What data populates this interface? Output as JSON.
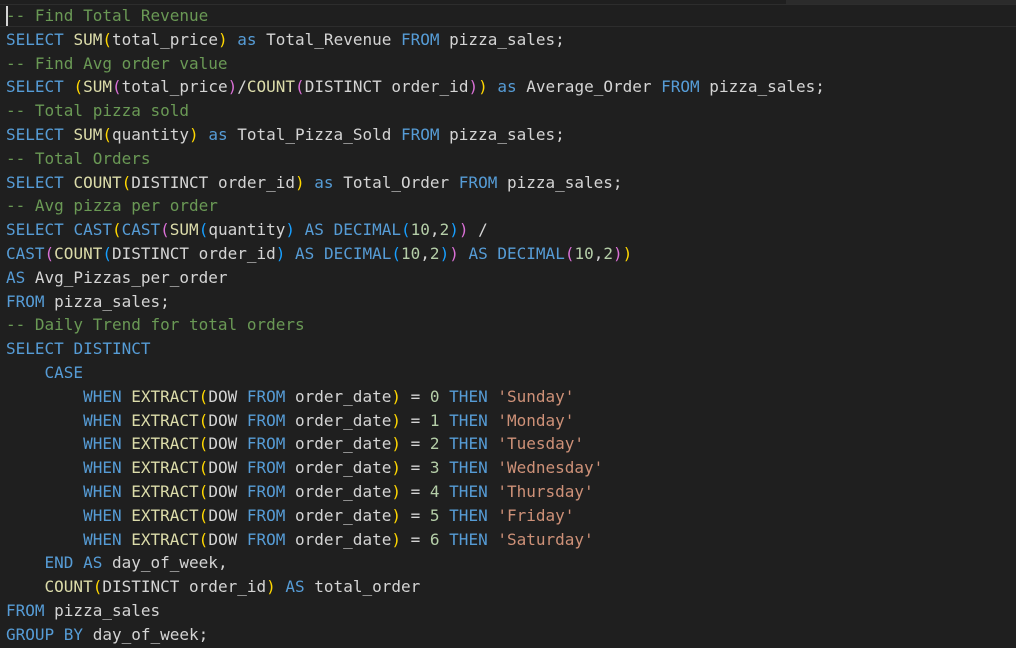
{
  "colors": {
    "background": "#1f1f1f",
    "default": "#d4d4d4",
    "keyword": "#569cd6",
    "function": "#dcdcaa",
    "comment": "#6a9955",
    "string": "#ce9178",
    "number": "#b5cea8",
    "paren1": "#ffd700",
    "paren2": "#da70d6",
    "paren3": "#179fff"
  },
  "editor": {
    "lines": [
      [
        [
          "comment",
          "-- Find Total Revenue"
        ]
      ],
      [
        [
          "keyword",
          "SELECT"
        ],
        [
          "default",
          " "
        ],
        [
          "function",
          "SUM"
        ],
        [
          "paren1",
          "("
        ],
        [
          "default",
          "total_price"
        ],
        [
          "paren1",
          ")"
        ],
        [
          "default",
          " "
        ],
        [
          "keyword",
          "as"
        ],
        [
          "default",
          " Total_Revenue "
        ],
        [
          "keyword",
          "FROM"
        ],
        [
          "default",
          " pizza_sales;"
        ]
      ],
      [
        [
          "comment",
          "-- Find Avg order value"
        ]
      ],
      [
        [
          "keyword",
          "SELECT"
        ],
        [
          "default",
          " "
        ],
        [
          "paren1",
          "("
        ],
        [
          "function",
          "SUM"
        ],
        [
          "paren2",
          "("
        ],
        [
          "default",
          "total_price"
        ],
        [
          "paren2",
          ")"
        ],
        [
          "default",
          "/"
        ],
        [
          "function",
          "COUNT"
        ],
        [
          "paren2",
          "("
        ],
        [
          "default",
          "DISTINCT order_id"
        ],
        [
          "paren2",
          ")"
        ],
        [
          "paren1",
          ")"
        ],
        [
          "default",
          " "
        ],
        [
          "keyword",
          "as"
        ],
        [
          "default",
          " Average_Order "
        ],
        [
          "keyword",
          "FROM"
        ],
        [
          "default",
          " pizza_sales;"
        ]
      ],
      [
        [
          "comment",
          "-- Total pizza sold"
        ]
      ],
      [
        [
          "keyword",
          "SELECT"
        ],
        [
          "default",
          " "
        ],
        [
          "function",
          "SUM"
        ],
        [
          "paren1",
          "("
        ],
        [
          "default",
          "quantity"
        ],
        [
          "paren1",
          ")"
        ],
        [
          "default",
          " "
        ],
        [
          "keyword",
          "as"
        ],
        [
          "default",
          " Total_Pizza_Sold "
        ],
        [
          "keyword",
          "FROM"
        ],
        [
          "default",
          " pizza_sales;"
        ]
      ],
      [
        [
          "comment",
          "-- Total Orders"
        ]
      ],
      [
        [
          "keyword",
          "SELECT"
        ],
        [
          "default",
          " "
        ],
        [
          "function",
          "COUNT"
        ],
        [
          "paren1",
          "("
        ],
        [
          "default",
          "DISTINCT order_id"
        ],
        [
          "paren1",
          ")"
        ],
        [
          "default",
          " "
        ],
        [
          "keyword",
          "as"
        ],
        [
          "default",
          " Total_Order "
        ],
        [
          "keyword",
          "FROM"
        ],
        [
          "default",
          " pizza_sales;"
        ]
      ],
      [
        [
          "comment",
          "-- Avg pizza per order"
        ]
      ],
      [
        [
          "keyword",
          "SELECT"
        ],
        [
          "default",
          " "
        ],
        [
          "keyword",
          "CAST"
        ],
        [
          "paren1",
          "("
        ],
        [
          "keyword",
          "CAST"
        ],
        [
          "paren2",
          "("
        ],
        [
          "function",
          "SUM"
        ],
        [
          "paren3",
          "("
        ],
        [
          "default",
          "quantity"
        ],
        [
          "paren3",
          ")"
        ],
        [
          "default",
          " "
        ],
        [
          "keyword",
          "AS"
        ],
        [
          "default",
          " "
        ],
        [
          "keyword",
          "DECIMAL"
        ],
        [
          "paren3",
          "("
        ],
        [
          "number",
          "10"
        ],
        [
          "default",
          ","
        ],
        [
          "number",
          "2"
        ],
        [
          "paren3",
          ")"
        ],
        [
          "paren2",
          ")"
        ],
        [
          "default",
          " /"
        ]
      ],
      [
        [
          "keyword",
          "CAST"
        ],
        [
          "paren2",
          "("
        ],
        [
          "function",
          "COUNT"
        ],
        [
          "paren3",
          "("
        ],
        [
          "default",
          "DISTINCT order_id"
        ],
        [
          "paren3",
          ")"
        ],
        [
          "default",
          " "
        ],
        [
          "keyword",
          "AS"
        ],
        [
          "default",
          " "
        ],
        [
          "keyword",
          "DECIMAL"
        ],
        [
          "paren3",
          "("
        ],
        [
          "number",
          "10"
        ],
        [
          "default",
          ","
        ],
        [
          "number",
          "2"
        ],
        [
          "paren3",
          ")"
        ],
        [
          "paren2",
          ")"
        ],
        [
          "default",
          " "
        ],
        [
          "keyword",
          "AS"
        ],
        [
          "default",
          " "
        ],
        [
          "keyword",
          "DECIMAL"
        ],
        [
          "paren2",
          "("
        ],
        [
          "number",
          "10"
        ],
        [
          "default",
          ","
        ],
        [
          "number",
          "2"
        ],
        [
          "paren2",
          ")"
        ],
        [
          "paren1",
          ")"
        ]
      ],
      [
        [
          "keyword",
          "AS"
        ],
        [
          "default",
          " Avg_Pizzas_per_order"
        ]
      ],
      [
        [
          "keyword",
          "FROM"
        ],
        [
          "default",
          " pizza_sales;"
        ]
      ],
      [
        [
          "comment",
          "-- Daily Trend for total orders"
        ]
      ],
      [
        [
          "keyword",
          "SELECT"
        ],
        [
          "default",
          " "
        ],
        [
          "keyword",
          "DISTINCT"
        ]
      ],
      [
        [
          "default",
          "    "
        ],
        [
          "keyword",
          "CASE"
        ]
      ],
      [
        [
          "default",
          "        "
        ],
        [
          "keyword",
          "WHEN"
        ],
        [
          "default",
          " "
        ],
        [
          "function",
          "EXTRACT"
        ],
        [
          "paren1",
          "("
        ],
        [
          "default",
          "DOW "
        ],
        [
          "keyword",
          "FROM"
        ],
        [
          "default",
          " order_date"
        ],
        [
          "paren1",
          ")"
        ],
        [
          "default",
          " = "
        ],
        [
          "number",
          "0"
        ],
        [
          "default",
          " "
        ],
        [
          "keyword",
          "THEN"
        ],
        [
          "default",
          " "
        ],
        [
          "string",
          "'Sunday'"
        ]
      ],
      [
        [
          "default",
          "        "
        ],
        [
          "keyword",
          "WHEN"
        ],
        [
          "default",
          " "
        ],
        [
          "function",
          "EXTRACT"
        ],
        [
          "paren1",
          "("
        ],
        [
          "default",
          "DOW "
        ],
        [
          "keyword",
          "FROM"
        ],
        [
          "default",
          " order_date"
        ],
        [
          "paren1",
          ")"
        ],
        [
          "default",
          " = "
        ],
        [
          "number",
          "1"
        ],
        [
          "default",
          " "
        ],
        [
          "keyword",
          "THEN"
        ],
        [
          "default",
          " "
        ],
        [
          "string",
          "'Monday'"
        ]
      ],
      [
        [
          "default",
          "        "
        ],
        [
          "keyword",
          "WHEN"
        ],
        [
          "default",
          " "
        ],
        [
          "function",
          "EXTRACT"
        ],
        [
          "paren1",
          "("
        ],
        [
          "default",
          "DOW "
        ],
        [
          "keyword",
          "FROM"
        ],
        [
          "default",
          " order_date"
        ],
        [
          "paren1",
          ")"
        ],
        [
          "default",
          " = "
        ],
        [
          "number",
          "2"
        ],
        [
          "default",
          " "
        ],
        [
          "keyword",
          "THEN"
        ],
        [
          "default",
          " "
        ],
        [
          "string",
          "'Tuesday'"
        ]
      ],
      [
        [
          "default",
          "        "
        ],
        [
          "keyword",
          "WHEN"
        ],
        [
          "default",
          " "
        ],
        [
          "function",
          "EXTRACT"
        ],
        [
          "paren1",
          "("
        ],
        [
          "default",
          "DOW "
        ],
        [
          "keyword",
          "FROM"
        ],
        [
          "default",
          " order_date"
        ],
        [
          "paren1",
          ")"
        ],
        [
          "default",
          " = "
        ],
        [
          "number",
          "3"
        ],
        [
          "default",
          " "
        ],
        [
          "keyword",
          "THEN"
        ],
        [
          "default",
          " "
        ],
        [
          "string",
          "'Wednesday'"
        ]
      ],
      [
        [
          "default",
          "        "
        ],
        [
          "keyword",
          "WHEN"
        ],
        [
          "default",
          " "
        ],
        [
          "function",
          "EXTRACT"
        ],
        [
          "paren1",
          "("
        ],
        [
          "default",
          "DOW "
        ],
        [
          "keyword",
          "FROM"
        ],
        [
          "default",
          " order_date"
        ],
        [
          "paren1",
          ")"
        ],
        [
          "default",
          " = "
        ],
        [
          "number",
          "4"
        ],
        [
          "default",
          " "
        ],
        [
          "keyword",
          "THEN"
        ],
        [
          "default",
          " "
        ],
        [
          "string",
          "'Thursday'"
        ]
      ],
      [
        [
          "default",
          "        "
        ],
        [
          "keyword",
          "WHEN"
        ],
        [
          "default",
          " "
        ],
        [
          "function",
          "EXTRACT"
        ],
        [
          "paren1",
          "("
        ],
        [
          "default",
          "DOW "
        ],
        [
          "keyword",
          "FROM"
        ],
        [
          "default",
          " order_date"
        ],
        [
          "paren1",
          ")"
        ],
        [
          "default",
          " = "
        ],
        [
          "number",
          "5"
        ],
        [
          "default",
          " "
        ],
        [
          "keyword",
          "THEN"
        ],
        [
          "default",
          " "
        ],
        [
          "string",
          "'Friday'"
        ]
      ],
      [
        [
          "default",
          "        "
        ],
        [
          "keyword",
          "WHEN"
        ],
        [
          "default",
          " "
        ],
        [
          "function",
          "EXTRACT"
        ],
        [
          "paren1",
          "("
        ],
        [
          "default",
          "DOW "
        ],
        [
          "keyword",
          "FROM"
        ],
        [
          "default",
          " order_date"
        ],
        [
          "paren1",
          ")"
        ],
        [
          "default",
          " = "
        ],
        [
          "number",
          "6"
        ],
        [
          "default",
          " "
        ],
        [
          "keyword",
          "THEN"
        ],
        [
          "default",
          " "
        ],
        [
          "string",
          "'Saturday'"
        ]
      ],
      [
        [
          "default",
          "    "
        ],
        [
          "keyword",
          "END"
        ],
        [
          "default",
          " "
        ],
        [
          "keyword",
          "AS"
        ],
        [
          "default",
          " day_of_week,"
        ]
      ],
      [
        [
          "default",
          "    "
        ],
        [
          "function",
          "COUNT"
        ],
        [
          "paren1",
          "("
        ],
        [
          "default",
          "DISTINCT order_id"
        ],
        [
          "paren1",
          ")"
        ],
        [
          "default",
          " "
        ],
        [
          "keyword",
          "AS"
        ],
        [
          "default",
          " total_order"
        ]
      ],
      [
        [
          "keyword",
          "FROM"
        ],
        [
          "default",
          " pizza_sales"
        ]
      ],
      [
        [
          "keyword",
          "GROUP BY"
        ],
        [
          "default",
          " day_of_week;"
        ]
      ]
    ]
  }
}
